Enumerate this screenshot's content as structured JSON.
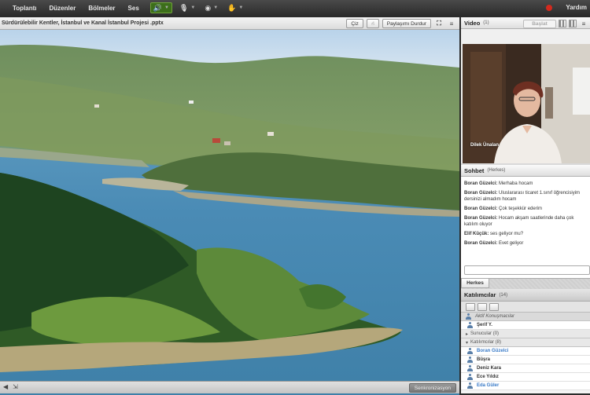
{
  "menubar": {
    "items": [
      "Toplantı",
      "Düzenler",
      "Bölmeler",
      "Ses"
    ],
    "help": "Yardım"
  },
  "share": {
    "title": "Sürdürülebilir Kentler, İstanbul ve Kanal İstanbul Projesi .pptx",
    "draw_label": "Çiz",
    "stop_sharing_label": "Paylaşımı Durdur",
    "sync_label": "Senkronizasyon"
  },
  "video": {
    "title": "Video",
    "count": "(1)",
    "start_label": "Başlat",
    "participant_name": "Dilek Ünalan"
  },
  "chat": {
    "title": "Sohbet",
    "scope": "(Herkes)",
    "tab_label": "Herkes",
    "messages": [
      {
        "sender": "Boran Güzelci:",
        "text": "Merhaba hocam"
      },
      {
        "sender": "Boran Güzelci:",
        "text": "Uluslararası ticaret 1.sınıf öğrencisiyim dersinizi almadım hocam"
      },
      {
        "sender": "Boran Güzelci:",
        "text": "Çok teşekkür ederim"
      },
      {
        "sender": "Boran Güzelci:",
        "text": "Hocam akşam saatlerinde daha çok katılım oluyor"
      },
      {
        "sender": "Elif Küçük:",
        "text": "ses geliyor mu?"
      },
      {
        "sender": "Boran Güzelci:",
        "text": "Evet geliyor"
      }
    ]
  },
  "attendees": {
    "title": "Katılımcılar",
    "count": "(14)",
    "active_speakers_label": "Aktif Konuşmacılar",
    "host": "Şerif Y.",
    "presenters_label": "Sunucular (0)",
    "participants_label": "Katılımcılar (8)",
    "participants": [
      "Boran Güzelci",
      "Büşra",
      "Deniz Kara",
      "Ece Yıldız",
      "Eda Güler"
    ]
  },
  "colors": {
    "accent_green": "#3c6e1a",
    "record_red": "#d32a1e",
    "link_blue": "#3a7bc8"
  }
}
